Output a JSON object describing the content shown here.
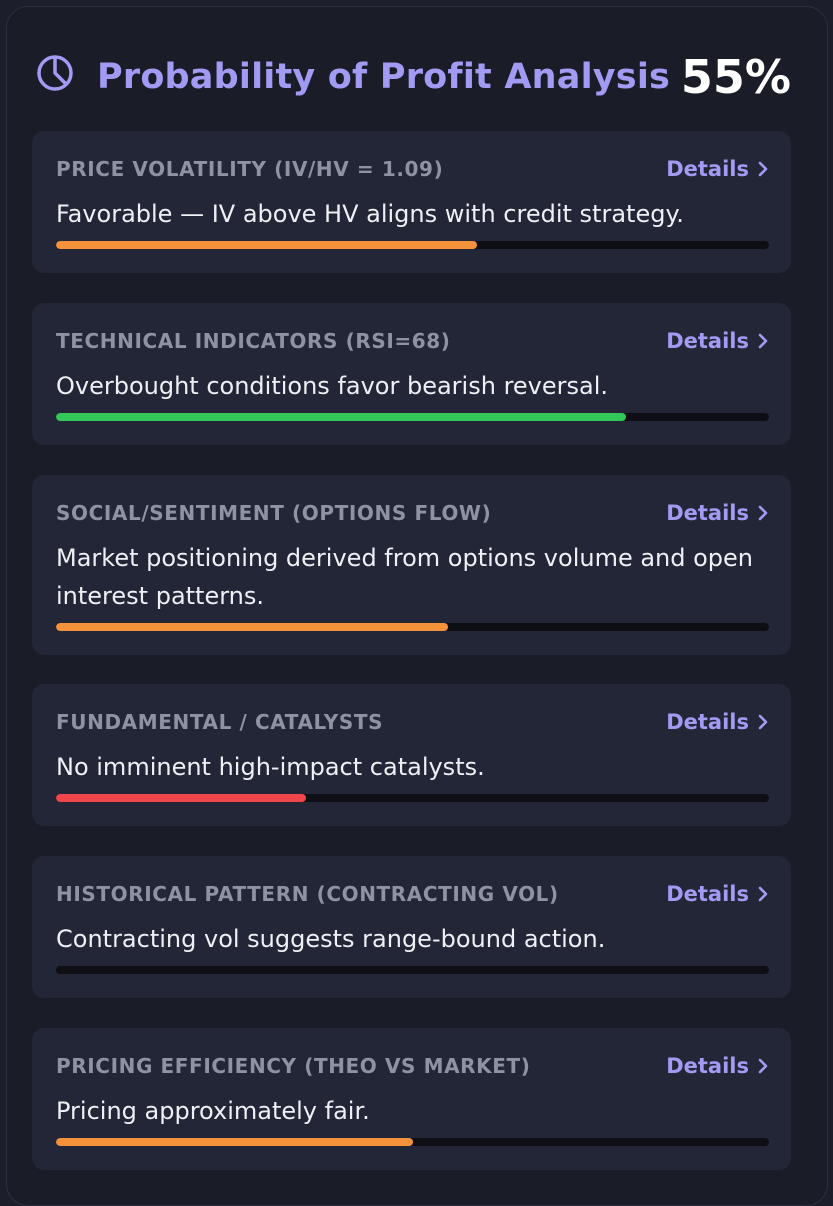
{
  "header": {
    "icon": "pie-chart-icon",
    "title": "Probability of Profit Analysis",
    "score": "55%"
  },
  "details_label": "Details",
  "colors": {
    "accent": "#a29bf4",
    "orange": "#f5913a",
    "green": "#34c759",
    "red": "#f0454a",
    "track": "#0e0f15"
  },
  "factors": [
    {
      "title": "PRICE VOLATILITY (IV/HV = 1.09)",
      "description": "Favorable — IV above HV aligns with credit strategy.",
      "progress": 0.59,
      "color": "#f5913a"
    },
    {
      "title": "TECHNICAL INDICATORS (RSI=68)",
      "description": "Overbought conditions favor bearish reversal.",
      "progress": 0.8,
      "color": "#34c759"
    },
    {
      "title": "SOCIAL/SENTIMENT (OPTIONS FLOW)",
      "description": "Market positioning derived from options volume and open interest patterns.",
      "progress": 0.55,
      "color": "#f5913a"
    },
    {
      "title": "FUNDAMENTAL / CATALYSTS",
      "description": "No imminent high-impact catalysts.",
      "progress": 0.35,
      "color": "#f0454a"
    },
    {
      "title": "HISTORICAL PATTERN (CONTRACTING VOL)",
      "description": "Contracting vol suggests range-bound action.",
      "progress": 0.0,
      "color": "#f5913a"
    },
    {
      "title": "PRICING EFFICIENCY (THEO VS MARKET)",
      "description": "Pricing approximately fair.",
      "progress": 0.5,
      "color": "#f5913a"
    }
  ]
}
